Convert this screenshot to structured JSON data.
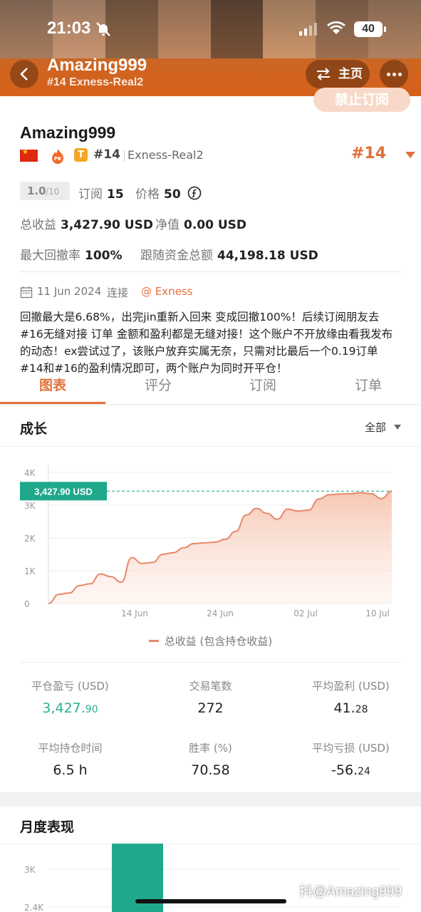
{
  "status": {
    "time": "21:03",
    "battery": "40"
  },
  "header": {
    "title": "Amazing999",
    "subtitle": "#14 Exness-Real2",
    "home_label": "主页",
    "subscribe_label": "禁止订阅"
  },
  "profile": {
    "name": "Amazing999",
    "rank_small": "#14",
    "server": "Exness-Real2",
    "rank_big": "#14",
    "rating": "1.0",
    "rating_max": "/10",
    "subscribe_label": "订阅",
    "subscribe_count": "15",
    "price_label": "价格",
    "price_value": "50",
    "total_profit_label": "总收益",
    "total_profit_value": "3,427.90 USD",
    "equity_label": "净值",
    "equity_value": "0.00 USD",
    "drawdown_label": "最大回撤率",
    "drawdown_value": "100%",
    "follow_funds_label": "跟随资金总额",
    "follow_funds_value": "44,198.18 USD",
    "date": "11 Jun 2024",
    "connect_label": "连接",
    "broker": "@ Exness",
    "description": "回撤最大是6.68%，出完jin重新入回来 变成回撤100%！后续订阅朋友去#16无缝对接 订单 金额和盈利都是无缝对接！这个账户不开放缘由看我发布的动态！ex尝试过了，该账户放弃实属无奈，只需对比最后一个0.19订单#14和#16的盈利情况即可，两个账户为同时开平仓！"
  },
  "tabs": [
    "图表",
    "评分",
    "订阅",
    "订单"
  ],
  "growth": {
    "title": "成长",
    "range": "全部",
    "legend": "总收益 (包含持仓收益)"
  },
  "chart_data": [
    {
      "type": "area",
      "title": "成长",
      "y_ticks": [
        "0",
        "1K",
        "2K",
        "3K",
        "4K"
      ],
      "ylim": [
        0,
        4000
      ],
      "x_ticks": [
        "14 Jun",
        "24 Jun",
        "02 Jul",
        "10 Jul"
      ],
      "current_label": "3,427.90 USD",
      "current_value": 3427.9,
      "series": [
        {
          "name": "总收益 (包含持仓收益)",
          "values": [
            0,
            280,
            320,
            550,
            600,
            900,
            820,
            650,
            1400,
            1220,
            1250,
            1500,
            1550,
            1700,
            1830,
            1850,
            1870,
            1960,
            2200,
            2700,
            2900,
            2750,
            2570,
            2880,
            2820,
            2850,
            3190,
            3320,
            3340,
            3350,
            3380,
            3350,
            3200,
            3427.9
          ]
        }
      ]
    },
    {
      "type": "bar",
      "title": "月度表现",
      "y_ticks": [
        "2.4K",
        "3K"
      ],
      "values": [
        3427.9
      ]
    }
  ],
  "metrics": [
    {
      "label": "平仓盈亏 (USD)",
      "value": "3,427.",
      "decimals": "90",
      "green": true
    },
    {
      "label": "交易笔数",
      "value": "272",
      "decimals": "",
      "green": false
    },
    {
      "label": "平均盈利 (USD)",
      "value": "41.",
      "decimals": "28",
      "green": false
    },
    {
      "label": "平均持仓时间",
      "value": "6.5 h",
      "decimals": "",
      "green": false
    },
    {
      "label": "胜率 (%)",
      "value": "70.58",
      "decimals": "",
      "green": false
    },
    {
      "label": "平均亏损 (USD)",
      "value": "-56.",
      "decimals": "24",
      "green": false
    }
  ],
  "monthly": {
    "title": "月度表现"
  },
  "watermark": "抖@Amazing999",
  "colors": {
    "accent": "#e2703a",
    "green": "#2ab08f",
    "teal_bar": "#1fa88c"
  }
}
